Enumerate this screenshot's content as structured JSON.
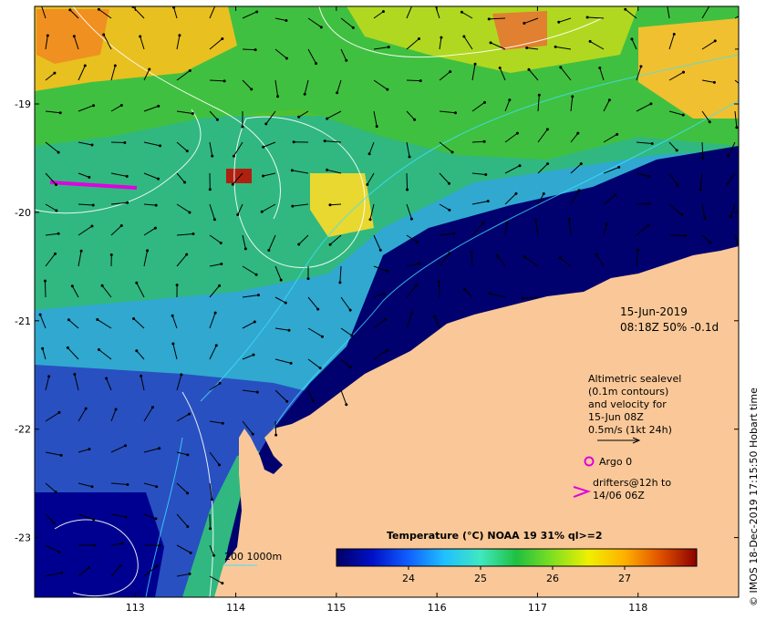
{
  "map": {
    "lat_labels": [
      {
        "value": -19,
        "label": "-19"
      },
      {
        "value": -20,
        "label": "-20"
      },
      {
        "value": -21,
        "label": "-21"
      },
      {
        "value": -22,
        "label": "-22"
      },
      {
        "value": -23,
        "label": "-23"
      }
    ],
    "lon_labels": [
      {
        "value": 113,
        "label": "113"
      },
      {
        "value": 114,
        "label": "114"
      },
      {
        "value": 115,
        "label": "115"
      },
      {
        "value": 116,
        "label": "116"
      },
      {
        "value": 117,
        "label": "117"
      },
      {
        "value": 118,
        "label": "118"
      }
    ],
    "lon_range": [
      112.0,
      119.0
    ],
    "lat_range": [
      -23.55,
      -18.1
    ],
    "land_color": "#fac898",
    "deep_color": "#00006e"
  },
  "date": {
    "date": "15-Jun-2019",
    "time_line": "08:18Z  50% -0.1d"
  },
  "altimetry": {
    "line1": "Altimetric sealevel",
    "line2": "(0.1m contours)",
    "line3": "and velocity for",
    "line4": "15-Jun 08Z",
    "line5": "0.5m/s (1kt 24h)"
  },
  "argo": {
    "label": "Argo 0",
    "color": "#e000e0"
  },
  "drifters": {
    "line1": "drifters@12h to",
    "line2": "14/06 06Z",
    "color": "#e000e0"
  },
  "bathy": {
    "label": "200  1000m",
    "color": "#40e0ff"
  },
  "colorbar": {
    "title": "Temperature (°C) NOAA 19 31% ql>=2",
    "range": [
      23.0,
      28.0
    ],
    "tick_labels": [
      {
        "value": 24,
        "label": "24"
      },
      {
        "value": 25,
        "label": "25"
      },
      {
        "value": 26,
        "label": "26"
      },
      {
        "value": 27,
        "label": "27"
      }
    ]
  },
  "credit": "© IMOS 18-Dec-2019 17:15:50 Hobart time"
}
